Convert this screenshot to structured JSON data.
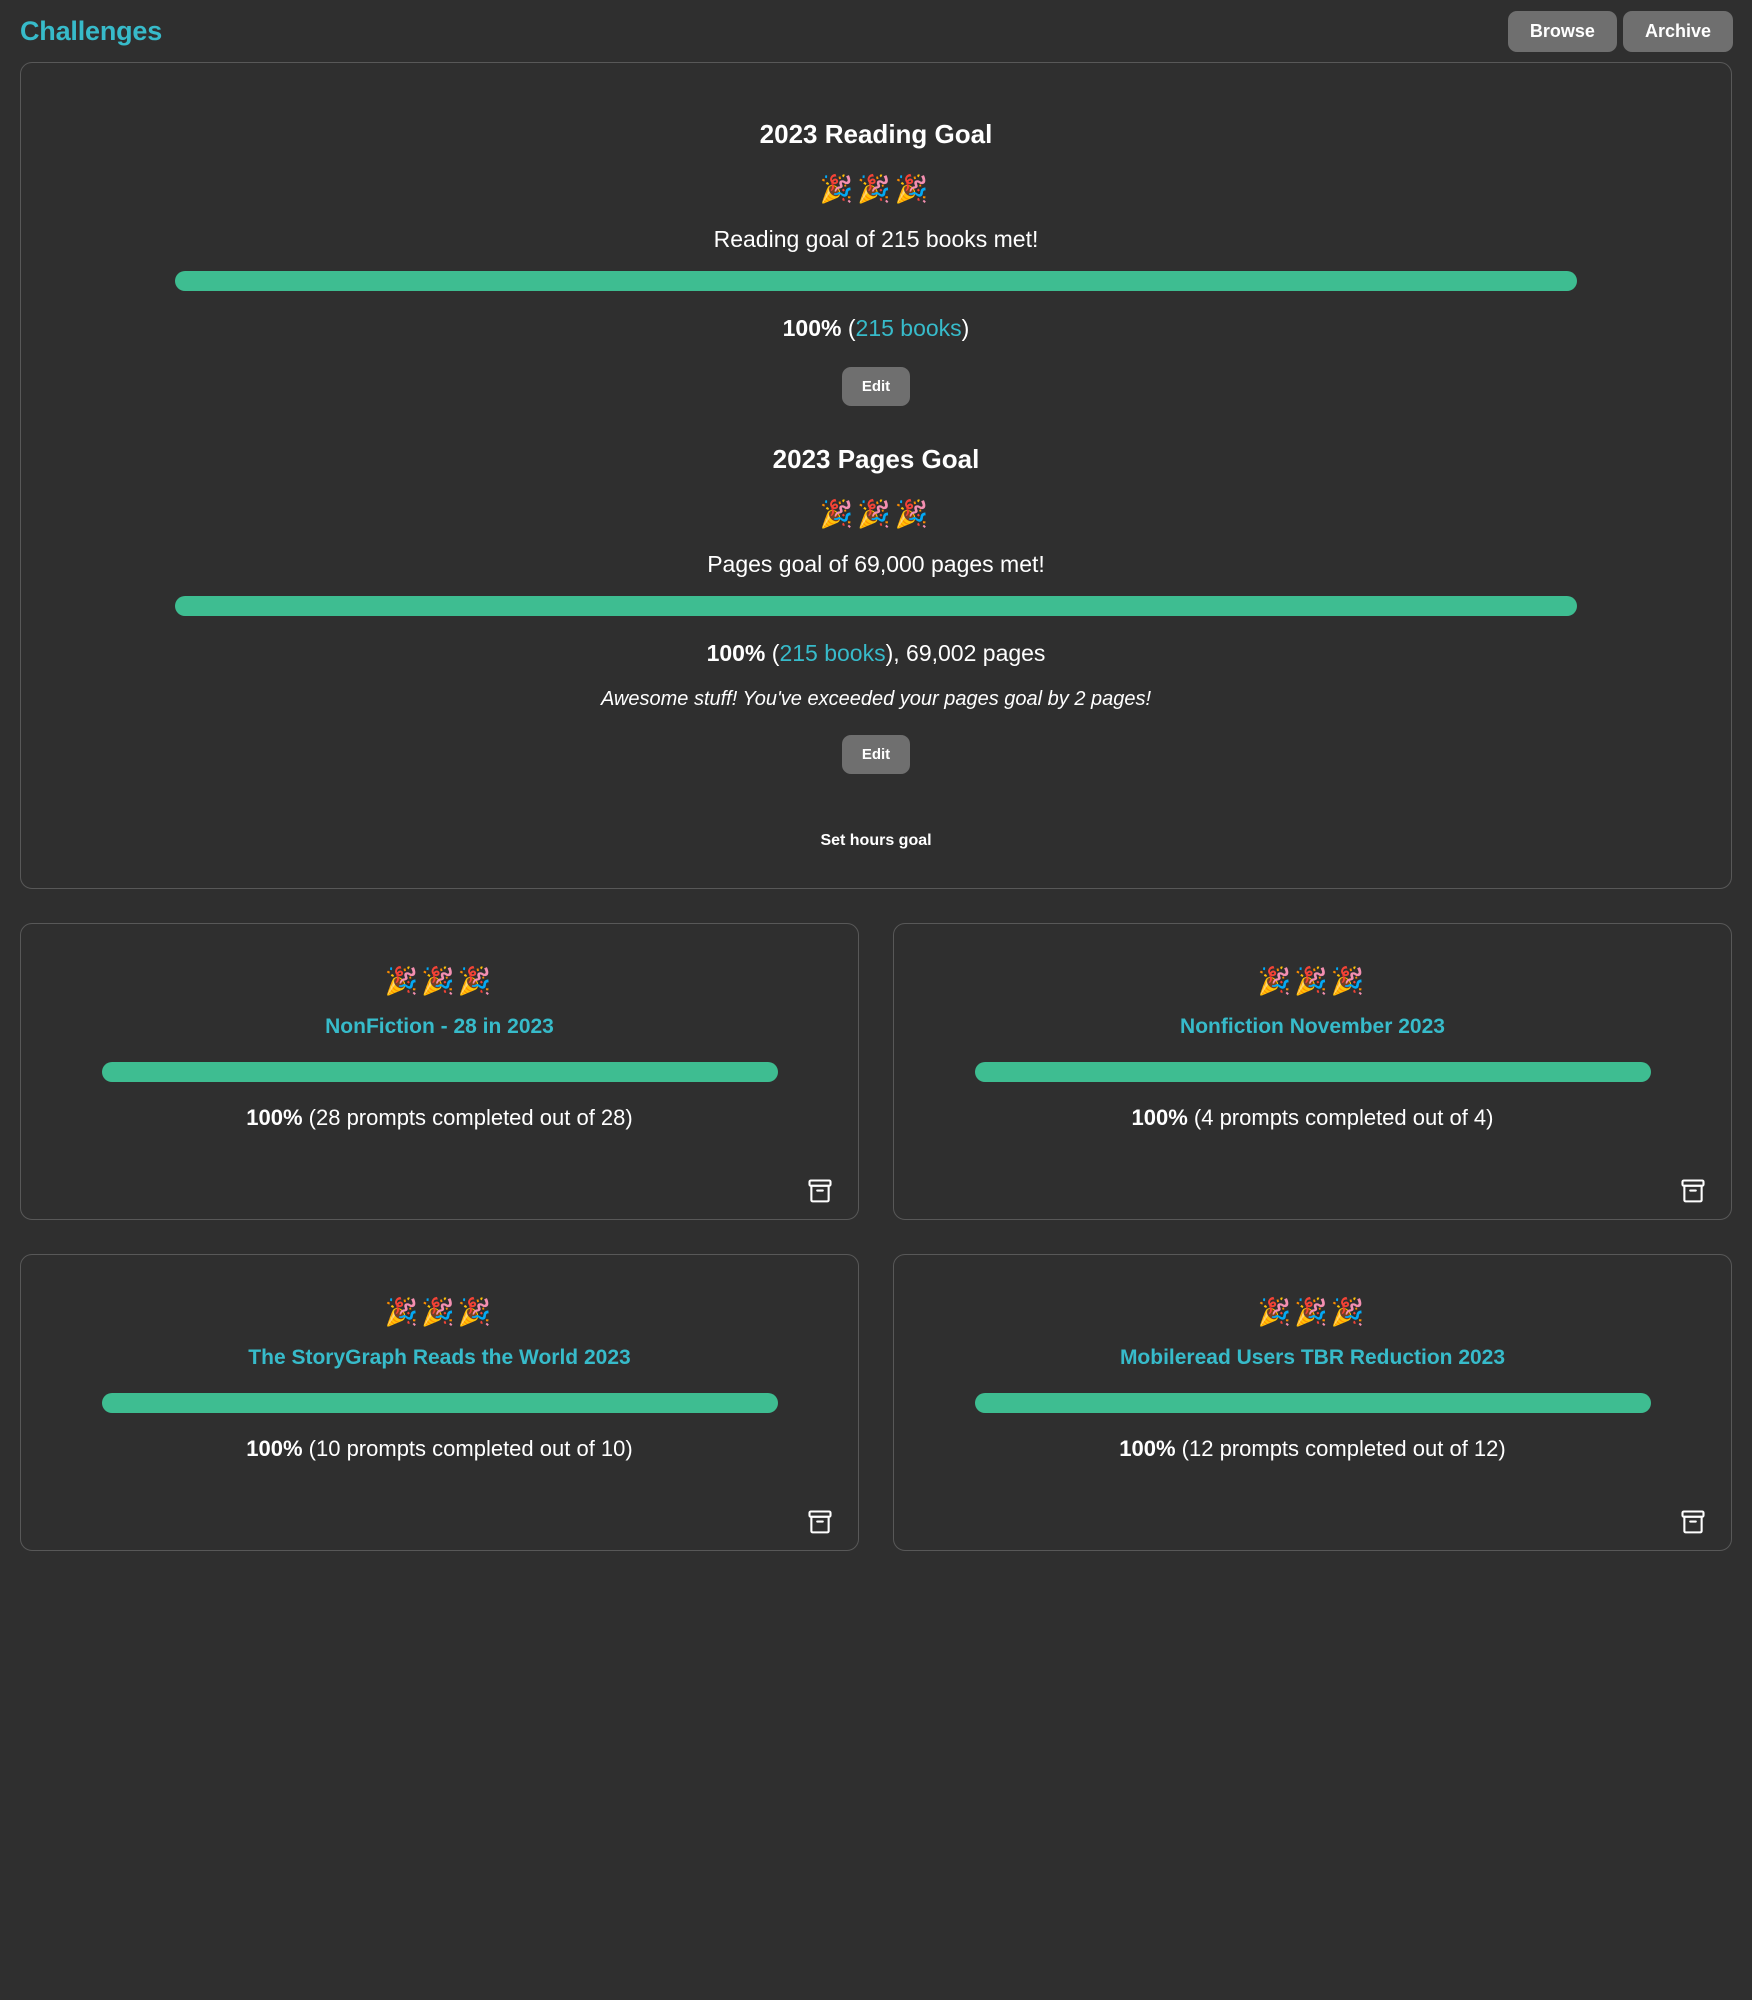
{
  "header": {
    "title": "Challenges",
    "browse_label": "Browse",
    "archive_label": "Archive"
  },
  "colors": {
    "accent_teal": "#37bbca",
    "progress_green": "#3ebd91",
    "background": "#2f2f2f",
    "button_gray": "#6f6f6f",
    "card_border": "#585858"
  },
  "goals": {
    "reading": {
      "title": "2023 Reading Goal",
      "confetti": "🎉🎉🎉",
      "message": "Reading goal of 215 books met!",
      "percent_label": "100%",
      "open_paren": " (",
      "books_link": "215 books",
      "close_paren": ")",
      "progress_percent": 100,
      "edit_label": "Edit"
    },
    "pages": {
      "title": "2023 Pages Goal",
      "confetti": "🎉🎉🎉",
      "message": "Pages goal of 69,000 pages met!",
      "percent_label": "100%",
      "open_paren": " (",
      "books_link": "215 books",
      "close_paren": "), 69,002 pages",
      "progress_percent": 100,
      "note": "Awesome stuff! You've exceeded your pages goal by 2 pages!",
      "edit_label": "Edit"
    },
    "hours_goal_label": "Set hours goal"
  },
  "challenges": [
    {
      "confetti": "🎉🎉🎉",
      "title": "NonFiction - 28 in 2023",
      "percent_label": "100%",
      "detail": " (28 prompts completed out of 28)",
      "progress_percent": 100,
      "archive_icon": "archive-icon"
    },
    {
      "confetti": "🎉🎉🎉",
      "title": "Nonfiction November 2023",
      "percent_label": "100%",
      "detail": " (4 prompts completed out of 4)",
      "progress_percent": 100,
      "archive_icon": "archive-icon"
    },
    {
      "confetti": "🎉🎉🎉",
      "title": "The StoryGraph Reads the World 2023",
      "percent_label": "100%",
      "detail": " (10 prompts completed out of 10)",
      "progress_percent": 100,
      "archive_icon": "archive-icon"
    },
    {
      "confetti": "🎉🎉🎉",
      "title": "Mobileread Users TBR Reduction 2023",
      "percent_label": "100%",
      "detail": " (12 prompts completed out of 12)",
      "progress_percent": 100,
      "archive_icon": "archive-icon"
    }
  ]
}
